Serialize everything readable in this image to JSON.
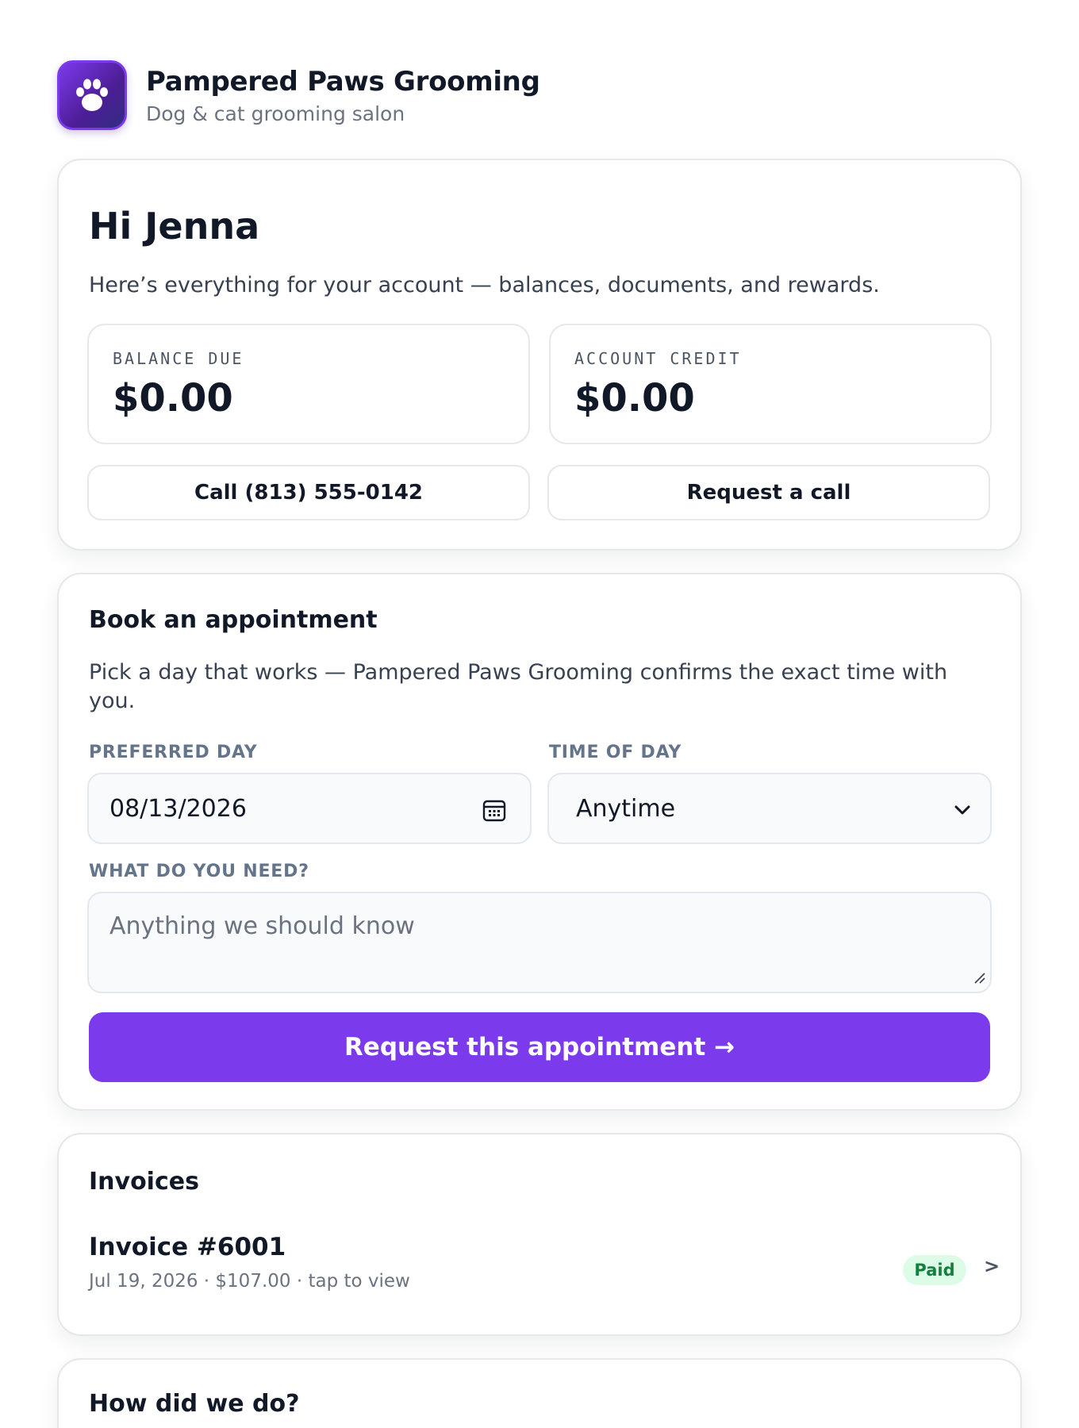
{
  "brand": {
    "name": "Pampered Paws Grooming",
    "tagline": "Dog & cat grooming salon",
    "logo_icon": "paw-icon",
    "accent_color": "#7c3aed"
  },
  "account": {
    "greeting": "Hi Jenna",
    "intro": "Here’s everything for your account — balances, documents, and rewards.",
    "balance_label": "BALANCE DUE",
    "balance_value": "$0.00",
    "credit_label": "ACCOUNT CREDIT",
    "credit_value": "$0.00",
    "call_button": "Call (813) 555-0142",
    "request_call_button": "Request a call"
  },
  "booking": {
    "title": "Book an appointment",
    "description": "Pick a day that works — Pampered Paws Grooming confirms the exact time with you.",
    "day_label": "PREFERRED DAY",
    "day_value": "08/13/2026",
    "time_label": "TIME OF DAY",
    "time_value": "Anytime",
    "need_label": "WHAT DO YOU NEED?",
    "need_placeholder": "Anything we should know",
    "submit_button": "Request this appointment →"
  },
  "invoices": {
    "title": "Invoices",
    "items": [
      {
        "title": "Invoice #6001",
        "meta": "Jul 19, 2026 · $107.00 · tap to view",
        "status": "Paid",
        "chevron": ">"
      }
    ]
  },
  "feedback": {
    "title": "How did we do?"
  }
}
